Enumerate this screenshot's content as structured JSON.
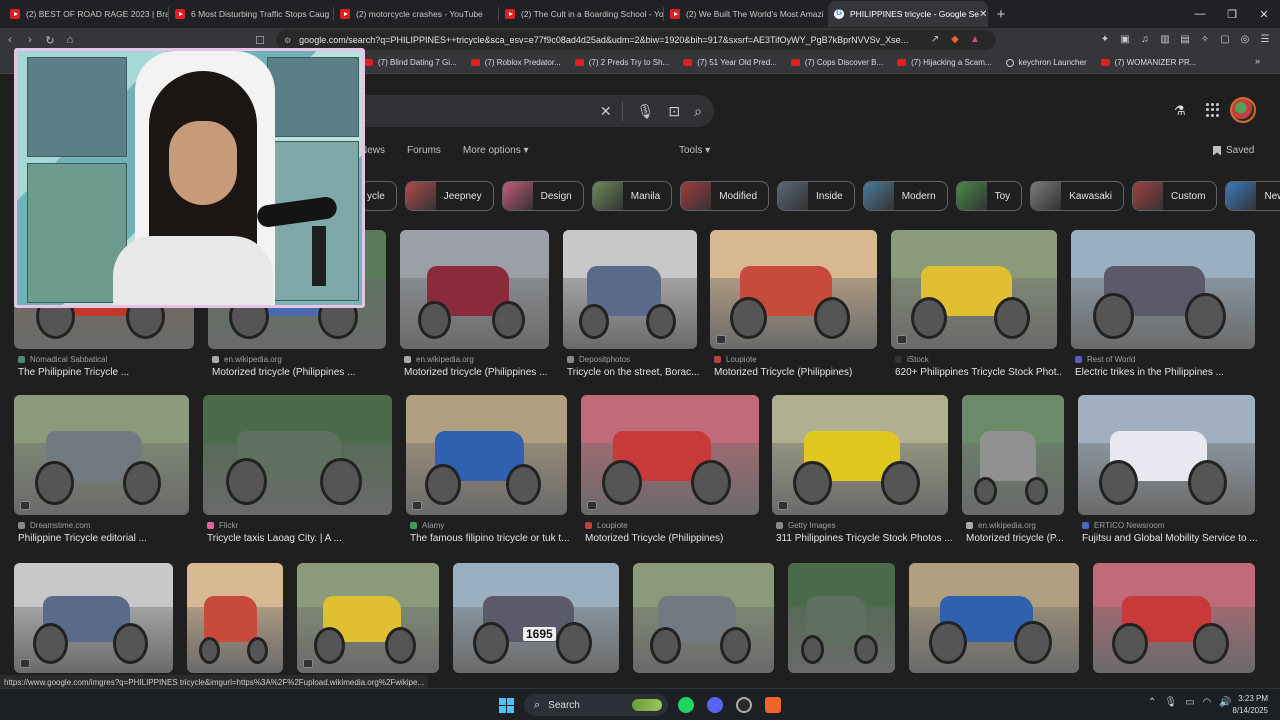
{
  "browser": {
    "tabs": [
      {
        "label": "(2) BEST OF ROAD RAGE 2023 | Brake",
        "icon": "youtube-icon"
      },
      {
        "label": "6 Most Disturbing Traffic Stops Caug",
        "icon": "youtube-icon"
      },
      {
        "label": "(2) motorcycle crashes - YouTube",
        "icon": "youtube-icon"
      },
      {
        "label": "(2) The Cult in a Boarding School - Yo",
        "icon": "youtube-icon"
      },
      {
        "label": "(2) We Built The World's Most Amazi",
        "icon": "youtube-icon"
      },
      {
        "label": "PHILIPPINES tricycle - Google Se",
        "icon": "google-icon",
        "active": true
      }
    ],
    "new_tab_label": "+",
    "url": "google.com/search?q=PHILIPPINES++tricycle&sca_esv=e77f9c08ad4d25ad&udm=2&biw=1920&bih=917&sxsrf=AE3TifOyWY_PgB7kBprNVVSv_Xse...",
    "bookmarks": [
      {
        "label": "(7) Blind Dating 7 Gi...",
        "icon": "youtube"
      },
      {
        "label": "(7) Roblox Predator...",
        "icon": "youtube"
      },
      {
        "label": "(7) 2 Preds Try to Sh...",
        "icon": "youtube"
      },
      {
        "label": "(7) 51 Year Old Pred...",
        "icon": "youtube"
      },
      {
        "label": "(7) Cops Discover B...",
        "icon": "youtube"
      },
      {
        "label": "(7) Hijacking a Scam...",
        "icon": "youtube"
      },
      {
        "label": "keychron Launcher",
        "icon": "keychron"
      },
      {
        "label": "(7) WOMANIZER PR...",
        "icon": "youtube"
      }
    ],
    "bookmarks_more": "»"
  },
  "google": {
    "filters": [
      "News",
      "Forums",
      "More options ▾"
    ],
    "tools": "Tools ▾",
    "saved": "Saved",
    "chips": [
      {
        "label": "ycle",
        "color": "#6a6a6a"
      },
      {
        "label": "Jeepney",
        "color": "#b04a4a"
      },
      {
        "label": "Design",
        "color": "#c85a7a"
      },
      {
        "label": "Manila",
        "color": "#6a8a5a"
      },
      {
        "label": "Modified",
        "color": "#a43a3a"
      },
      {
        "label": "Inside",
        "color": "#5a6a7a"
      },
      {
        "label": "Modern",
        "color": "#4a7a9a"
      },
      {
        "label": "Toy",
        "color": "#4a8a4a"
      },
      {
        "label": "Kawasaki",
        "color": "#7a7a7a"
      },
      {
        "label": "Custom",
        "color": "#a04040"
      },
      {
        "label": "New",
        "color": "#3a7ac0"
      }
    ],
    "results_row1": [
      {
        "source": "Nomadical Sabbatical",
        "title": "The Philippine Tricycle ...",
        "sc": "#4a8a6a"
      },
      {
        "source": "en.wikipedia.org",
        "title": "Motorized tricycle (Philippines ...",
        "sc": "#aaa"
      },
      {
        "source": "en.wikipedia.org",
        "title": "Motorized tricycle (Philippines ...",
        "sc": "#aaa"
      },
      {
        "source": "Depositphotos",
        "title": "Tricycle on the street, Borac...",
        "sc": "#888"
      },
      {
        "source": "Loupiote",
        "title": "Motorized Tricycle (Philippines)",
        "sc": "#c04040"
      },
      {
        "source": "iStock",
        "title": "620+ Philippines Tricycle Stock Phot...",
        "sc": "#333"
      },
      {
        "source": "Rest of World",
        "title": "Electric trikes in the Philippines ...",
        "sc": "#5a5ac0"
      }
    ],
    "results_row2": [
      {
        "source": "Dreamstime.com",
        "title": "Philippine Tricycle editorial ...",
        "sc": "#888"
      },
      {
        "source": "Flickr",
        "title": "Tricycle taxis Laoag City. | A ...",
        "sc": "#e060a0"
      },
      {
        "source": "Alamy",
        "title": "The famous filipino tricycle or tuk t...",
        "sc": "#3aa060"
      },
      {
        "source": "Loupiote",
        "title": "Motorized Tricycle (Philippines)",
        "sc": "#c04040"
      },
      {
        "source": "Getty Images",
        "title": "311 Philippines Tricycle Stock Photos ...",
        "sc": "#888"
      },
      {
        "source": "en.wikipedia.org",
        "title": "Motorized tricycle (P...",
        "sc": "#aaa"
      },
      {
        "source": "ERTICO Newsroom",
        "title": "Fujitsu and Global Mobility Service to ...",
        "sc": "#4a6ac0"
      }
    ],
    "row3_labels": {
      "plate": "1695"
    }
  },
  "status_url": "https://www.google.com/imgres?q=PHILIPPINES  tricycle&imgurl=https%3A%2F%2Fupload.wikimedia.org%2Fwikipe...",
  "taskbar": {
    "search_label": "Search",
    "time": "3:23 PM",
    "date": "8/14/2025"
  }
}
